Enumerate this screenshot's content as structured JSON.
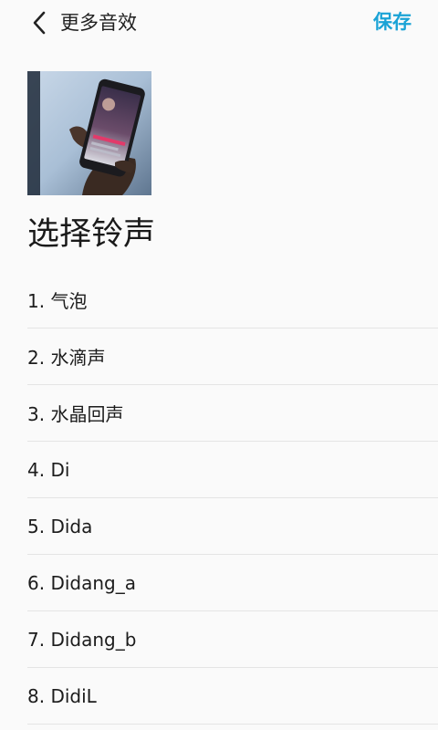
{
  "header": {
    "title": "更多音效",
    "save_label": "保存"
  },
  "section": {
    "heading": "选择铃声"
  },
  "ringtones": [
    "1. 气泡",
    "2. 水滴声",
    "3. 水晶回声",
    "4. Di",
    "5. Dida",
    "6. Didang_a",
    "7. Didang_b",
    "8. DidiL"
  ],
  "colors": {
    "accent": "#1aa3d6",
    "background": "#fafafa",
    "divider": "#e4e4e4"
  },
  "icons": {
    "back": "chevron-left-icon"
  }
}
